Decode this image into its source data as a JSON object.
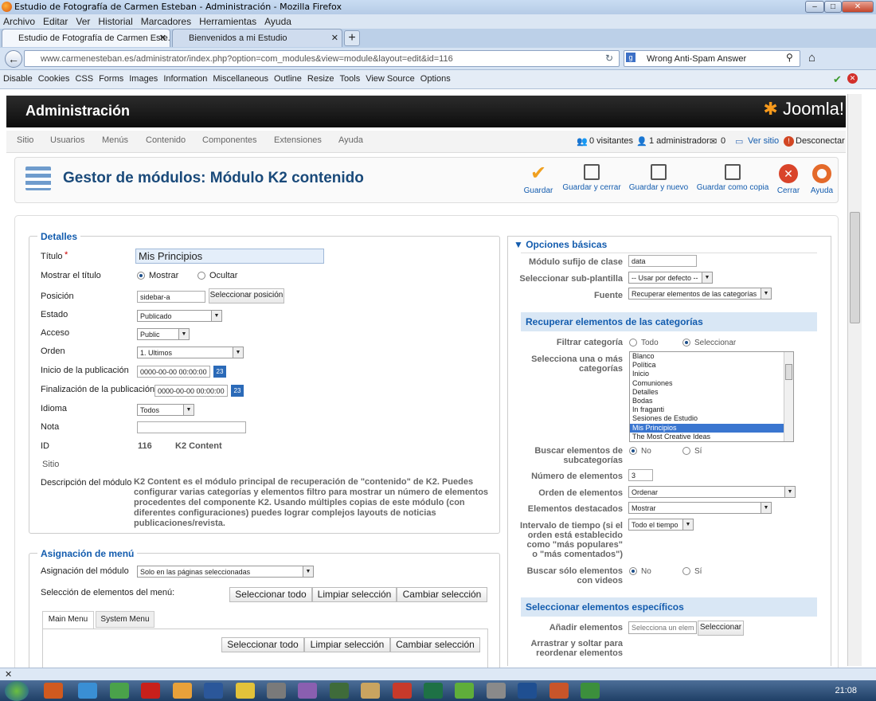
{
  "window": {
    "title": "Estudio de Fotografía de Carmen Esteban - Administración - Mozilla Firefox"
  },
  "menubar": [
    "Archivo",
    "Editar",
    "Ver",
    "Historial",
    "Marcadores",
    "Herramientas",
    "Ayuda"
  ],
  "tabs": [
    {
      "label": "Estudio de Fotografía de Carmen Este..."
    },
    {
      "label": "Bienvenidos a mi Estudio"
    }
  ],
  "url": "www.carmenesteban.es/administrator/index.php?option=com_modules&view=module&layout=edit&id=116",
  "search": "Wrong Anti-Spam Answer",
  "webdev": [
    "Disable",
    "Cookies",
    "CSS",
    "Forms",
    "Images",
    "Information",
    "Miscellaneous",
    "Outline",
    "Resize",
    "Tools",
    "View Source",
    "Options"
  ],
  "joomla": {
    "header": "Administración",
    "logo": "Joomla!",
    "menu": [
      "Sitio",
      "Usuarios",
      "Menús",
      "Contenido",
      "Componentes",
      "Extensiones",
      "Ayuda"
    ],
    "status": {
      "visitors": "0 visitantes",
      "admins": "1 administrador",
      "messages": "0",
      "view_site": "Ver sitio",
      "logout": "Desconectar"
    },
    "page_title": "Gestor de módulos: Módulo K2 contenido",
    "toolbar": [
      "Guardar",
      "Guardar y cerrar",
      "Guardar y nuevo",
      "Guardar como copia",
      "Cerrar",
      "Ayuda"
    ]
  },
  "details": {
    "legend": "Detalles",
    "titulo_label": "Título",
    "titulo_value": "Mis Principios",
    "required": "*",
    "mostrar_label": "Mostrar el título",
    "mostrar_opt": "Mostrar",
    "ocultar_opt": "Ocultar",
    "posicion_label": "Posición",
    "posicion_value": "sidebar-a",
    "posicion_btn": "Seleccionar posición",
    "estado_label": "Estado",
    "estado_value": "Publicado",
    "acceso_label": "Acceso",
    "acceso_value": "Public",
    "orden_label": "Orden",
    "orden_value": "1. Ultimos",
    "inicio_label": "Inicio de la publicación",
    "inicio_value": "0000-00-00 00:00:00",
    "fin_label": "Finalización de la publicación",
    "fin_value": "0000-00-00 00:00:00",
    "idioma_label": "Idioma",
    "idioma_value": "Todos",
    "nota_label": "Nota",
    "id_label": "ID",
    "id_value": "116",
    "id_type": "K2 Content",
    "sitio_label": "Sitio",
    "desc_label": "Descripción del módulo",
    "desc_text": "K2 Content es el módulo principal de recuperación de \"contenido\" de K2. Puedes configurar varias categorías y elementos filtro para mostrar un número de elementos procedentes del componente K2. Usando múltiples copias de este módulo (con diferentes configuraciones) puedes lograr complejos layouts de noticias publicaciones/revista."
  },
  "assign": {
    "legend": "Asignación de menú",
    "label": "Asignación del módulo",
    "value": "Solo en las páginas seleccionadas",
    "sel_label": "Selección de elementos del menú:",
    "btns": [
      "Seleccionar todo",
      "Limpiar selección",
      "Cambiar selección"
    ],
    "tabs": [
      "Main Menu",
      "System Menu"
    ]
  },
  "basic": {
    "legend": "Opciones básicas",
    "sufijo_label": "Módulo sufijo de clase",
    "sufijo_value": "data",
    "sub_label": "Seleccionar sub-plantilla",
    "sub_value": "-- Usar por defecto --",
    "fuente_label": "Fuente",
    "fuente_value": "Recuperar elementos de las categorías",
    "sect1": "Recuperar elementos de las categorías",
    "filtrar_label": "Filtrar categoría",
    "todo": "Todo",
    "seleccionar": "Seleccionar",
    "cats_label": "Selecciona una o más categorías",
    "categories": [
      "Blanco",
      "Política",
      "Inicio",
      "Comuniones",
      "Detalles",
      "Bodas",
      "In fraganti",
      "Sesiones de Estudio",
      "Mis Principios",
      "The Most Creative Ideas"
    ],
    "selected_category": "Mis Principios",
    "sub_cat_label": "Buscar elementos de subcategorías",
    "no": "No",
    "si": "Sí",
    "num_label": "Número de elementos",
    "num_value": "3",
    "orden_label": "Orden de elementos",
    "orden_value": "Ordenar",
    "dest_label": "Elementos destacados",
    "dest_value": "Mostrar",
    "intervalo_label": "Intervalo de tiempo (si el orden está establecido como \"más populares\" o \"más comentados\")",
    "intervalo_value": "Todo el tiempo",
    "videos_label": "Buscar sólo elementos con videos",
    "sect2": "Seleccionar elementos específicos",
    "anadir_label": "Añadir elementos",
    "anadir_placeholder": "Selecciona un elemento",
    "anadir_btn": "Seleccionar",
    "arrastrar_label": "Arrastrar y soltar para reordenar elementos"
  },
  "clock": "21:08"
}
